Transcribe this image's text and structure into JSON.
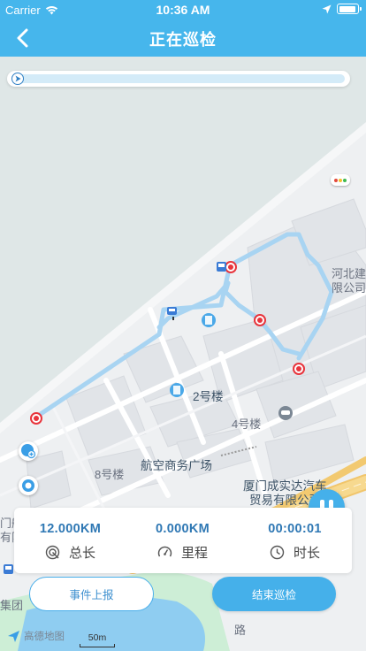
{
  "status_bar": {
    "carrier": "Carrier",
    "time": "10:36 AM",
    "battery_level": 0.95
  },
  "header": {
    "title": "正在巡检"
  },
  "progress": {
    "value": 0.01
  },
  "map": {
    "labels": {
      "building_2": "2号楼",
      "building_4": "4号楼",
      "building_8": "8号楼",
      "plaza": "航空商务广场",
      "company_line1": "厦门成实达汽车",
      "company_line2": "贸易有限公司",
      "hebei_line1": "河北建",
      "hebei_line2": "限公司",
      "left_line1": "门航空工",
      "left_line2": "有限公司",
      "left_line3": "集团",
      "road": "路",
      "road_2": "路",
      "road_3": "路"
    },
    "route_color": "#a8d4f2",
    "poi_color": "#e8343c"
  },
  "stats": {
    "total_length": {
      "value": "12.000KM",
      "label": "总长",
      "icon": "target-icon"
    },
    "mileage": {
      "value": "0.000KM",
      "label": "里程",
      "icon": "speedometer-icon"
    },
    "duration": {
      "value": "00:00:01",
      "label": "时长",
      "icon": "clock-icon"
    }
  },
  "buttons": {
    "report": "事件上报",
    "end": "结束巡检"
  },
  "footer": {
    "logo": "高德地图",
    "scale": "50m"
  }
}
